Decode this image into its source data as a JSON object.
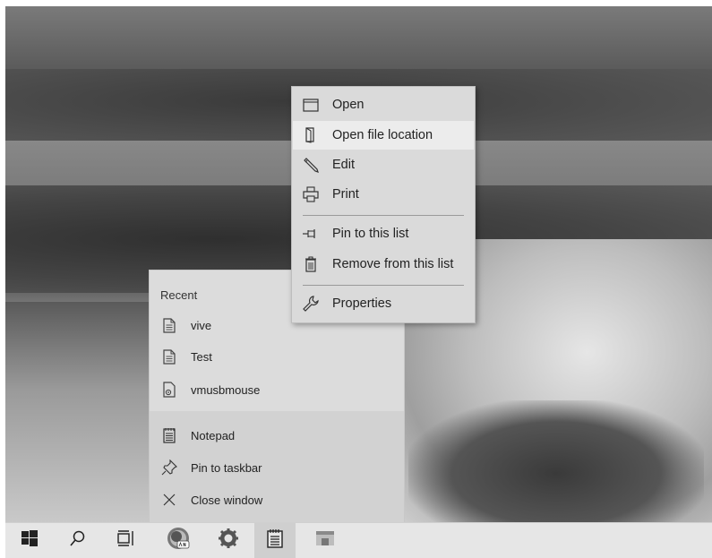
{
  "jumplist": {
    "header": "Recent",
    "recent": [
      {
        "label": "vive",
        "icon": "document-icon"
      },
      {
        "label": "Test",
        "icon": "document-icon"
      },
      {
        "label": "vmusbmouse",
        "icon": "settings-file-icon"
      }
    ],
    "actions": [
      {
        "label": "Notepad",
        "icon": "notepad-icon"
      },
      {
        "label": "Pin to taskbar",
        "icon": "pin-icon"
      },
      {
        "label": "Close window",
        "icon": "close-icon"
      }
    ]
  },
  "context_menu": {
    "items": [
      {
        "label": "Open",
        "icon": "window-icon"
      },
      {
        "label": "Open file location",
        "icon": "folder-location-icon",
        "highlighted": true
      },
      {
        "label": "Edit",
        "icon": "pencil-icon"
      },
      {
        "label": "Print",
        "icon": "printer-icon"
      },
      {
        "label": "Pin to this list",
        "icon": "pin-icon"
      },
      {
        "label": "Remove from this list",
        "icon": "trash-icon"
      },
      {
        "label": "Properties",
        "icon": "wrench-icon"
      }
    ]
  },
  "taskbar": {
    "items": [
      "start-icon",
      "search-icon",
      "task-view-icon",
      "can-app-icon",
      "settings-gear-icon",
      "notepad-icon",
      "window-app-icon"
    ],
    "active": "notepad-icon"
  }
}
